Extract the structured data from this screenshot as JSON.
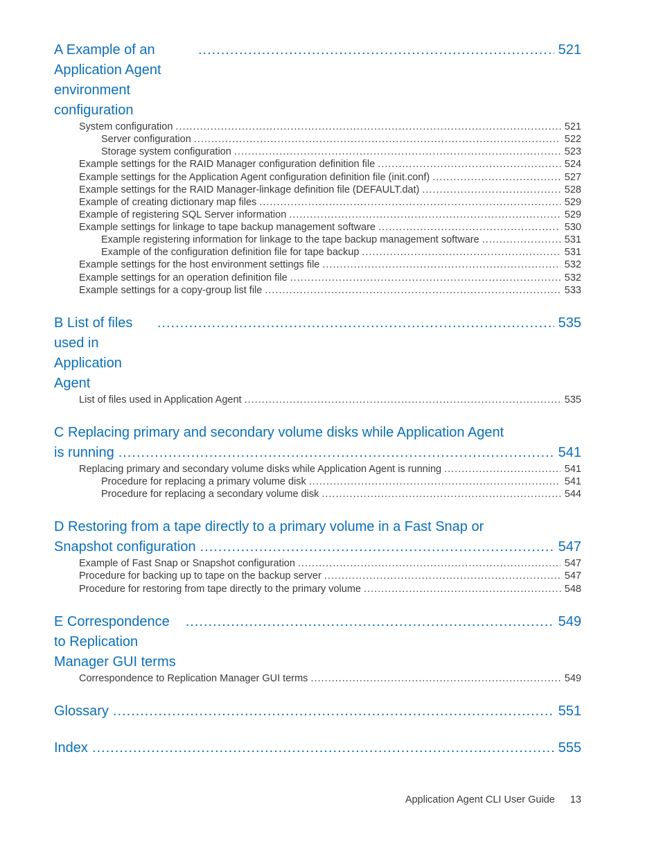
{
  "dots_long": "................................................................................................................................................................................................................",
  "sections": [
    {
      "lvl": 1,
      "title": "A Example of an Application Agent environment configuration",
      "page": "521",
      "children": [
        {
          "lvl": 2,
          "title": "System configuration",
          "page": "521"
        },
        {
          "lvl": 3,
          "title": "Server configuration",
          "page": "522"
        },
        {
          "lvl": 3,
          "title": "Storage system configuration",
          "page": "523"
        },
        {
          "lvl": 2,
          "title": "Example settings for the RAID Manager configuration definition file",
          "page": "524"
        },
        {
          "lvl": 2,
          "title": "Example settings for the Application Agent configuration definition file (init.conf)",
          "page": "527"
        },
        {
          "lvl": 2,
          "title": "Example settings for the RAID Manager-linkage definition file (DEFAULT.dat)",
          "page": "528"
        },
        {
          "lvl": 2,
          "title": "Example of creating dictionary map files",
          "page": "529"
        },
        {
          "lvl": 2,
          "title": "Example of registering SQL Server information",
          "page": "529"
        },
        {
          "lvl": 2,
          "title": "Example settings for linkage to tape backup management software",
          "page": "530"
        },
        {
          "lvl": 3,
          "title": "Example registering information for linkage to the tape backup management software",
          "page": "531"
        },
        {
          "lvl": 3,
          "title": "Example of the configuration definition file for tape backup",
          "page": "531"
        },
        {
          "lvl": 2,
          "title": "Example settings for the host environment settings file",
          "page": "532"
        },
        {
          "lvl": 2,
          "title": "Example settings for an operation definition file",
          "page": "532"
        },
        {
          "lvl": 2,
          "title": "Example settings for a copy-group list file",
          "page": "533"
        }
      ]
    },
    {
      "lvl": 1,
      "title": "B List of files used in Application Agent",
      "page": "535",
      "children": [
        {
          "lvl": 2,
          "title": "List of files used in Application Agent",
          "page": "535"
        }
      ]
    },
    {
      "lvl": 1,
      "multiline": true,
      "title_head": "C Replacing primary and secondary volume disks while Application Agent",
      "title_tail": "is running",
      "page": "541",
      "children": [
        {
          "lvl": 2,
          "title": "Replacing primary and secondary volume disks while Application Agent is running",
          "page": "541"
        },
        {
          "lvl": 3,
          "title": "Procedure for replacing a primary volume disk",
          "page": "541"
        },
        {
          "lvl": 3,
          "title": "Procedure for replacing a secondary volume disk",
          "page": "544"
        }
      ]
    },
    {
      "lvl": 1,
      "multiline": true,
      "title_head": "D Restoring from a tape directly to a primary volume in a Fast Snap or",
      "title_tail": "Snapshot configuration",
      "page": "547",
      "children": [
        {
          "lvl": 2,
          "title": "Example of Fast Snap or Snapshot configuration",
          "page": "547"
        },
        {
          "lvl": 2,
          "title": "Procedure for backing up to tape on the backup server",
          "page": "547"
        },
        {
          "lvl": 2,
          "title": "Procedure for restoring from tape directly to the primary volume",
          "page": "548"
        }
      ]
    },
    {
      "lvl": 1,
      "title": "E Correspondence to Replication Manager GUI terms",
      "page": "549",
      "children": [
        {
          "lvl": 2,
          "title": "Correspondence to Replication Manager GUI terms",
          "page": "549"
        }
      ]
    },
    {
      "lvl": 1,
      "title": "Glossary",
      "page": "551",
      "children": []
    },
    {
      "lvl": 1,
      "title": "Index",
      "page": "555",
      "children": []
    }
  ],
  "footer": {
    "text": "Application Agent CLI User Guide",
    "page_num": "13"
  }
}
